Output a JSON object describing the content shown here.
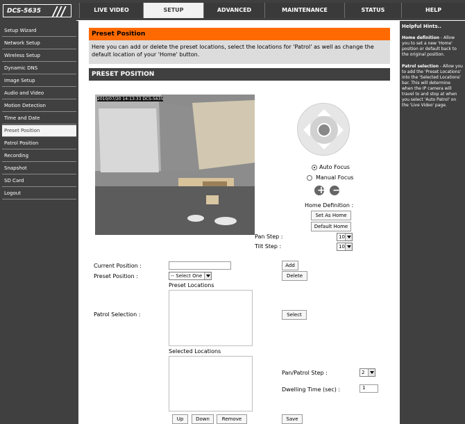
{
  "brand": {
    "product": "DCS-5635"
  },
  "tabs": [
    "LIVE VIDEO",
    "SETUP",
    "ADVANCED",
    "MAINTENANCE",
    "STATUS",
    "HELP"
  ],
  "sidebar": [
    "Setup Wizard",
    "Network Setup",
    "Wireless Setup",
    "Dynamic DNS",
    "Image Setup",
    "Audio and Video",
    "Motion Detection",
    "Time and Date",
    "Preset Position",
    "Patrol Position",
    "Recording",
    "Snapshot",
    "SD Card",
    "Logout"
  ],
  "header": {
    "title": "Preset Position",
    "intro": "Here you can add or delete the preset locations, select the locations for 'Patrol' as well as change the default location of your 'Home' button."
  },
  "section": {
    "title": "PRESET POSITION"
  },
  "camera": {
    "overlay": "2010/07/20 14:13:33 DCS-5635"
  },
  "focus": {
    "auto": "Auto Focus",
    "manual": "Manual Focus"
  },
  "controls": {
    "zoom_in": "+",
    "zoom_out": "−",
    "home_definition": "Home Definition :",
    "set_home": "Set As Home",
    "default_home": "Default Home",
    "pan_step_label": "Pan Step :",
    "tilt_step_label": "Tilt Step :",
    "pan_step_value": "10",
    "tilt_step_value": "10"
  },
  "form": {
    "current_position": "Current Position :",
    "preset_position": "Preset Position :",
    "select_one": "-- Select One --",
    "add": "Add",
    "delete": "Delete",
    "preset_locations": "Preset Locations",
    "patrol_selection": "Patrol Selection :",
    "select": "Select",
    "selected_locations": "Selected Locations",
    "pan_patrol_step": "Pan/Patrol Step :",
    "pan_patrol_value": "2",
    "dwelling": "Dwelling Time (sec) :",
    "dwelling_value": "1",
    "up": "Up",
    "down": "Down",
    "remove": "Remove",
    "save": "Save"
  },
  "help": {
    "title": "Helpful Hints..",
    "home_title": "Home definition",
    "home_text": " - Allow you to set a new 'Home' position or default back to the original position.",
    "patrol_title": "Patrol selection",
    "patrol_text": " - Allow you to add the 'Preset Locations' into the 'Selected Locations' bar. This will determine when the IP camera will travel to and stop at when you select 'Auto Patrol' on the 'Live Video' page."
  },
  "colors": {
    "orange": "#ff6a00",
    "dark": "#404040",
    "light": "#dcdcdc"
  }
}
